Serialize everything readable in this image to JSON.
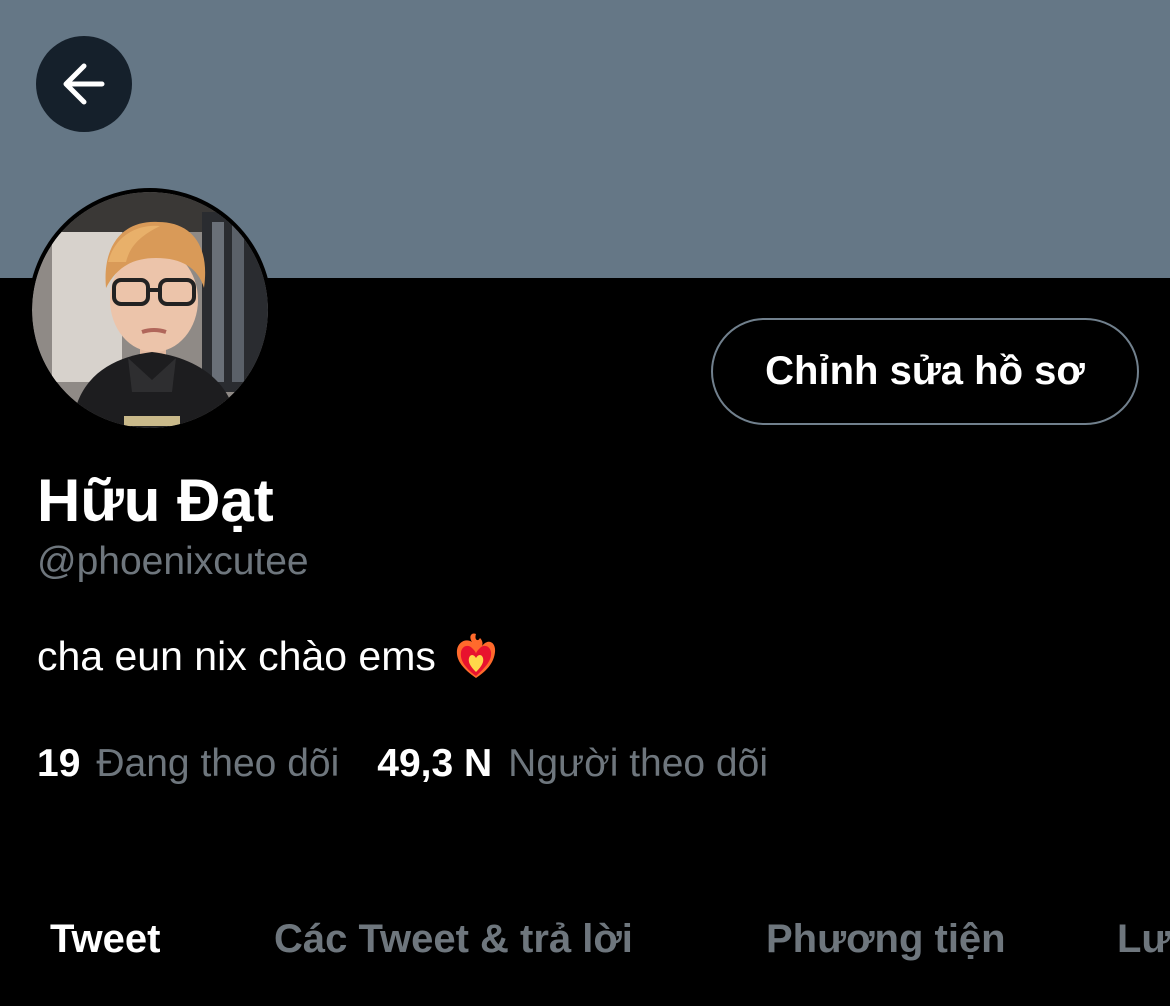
{
  "profile": {
    "edit_button": "Chỉnh sửa hồ sơ",
    "display_name": "Hữu Đạt",
    "handle": "@phoenixcutee",
    "bio": "cha eun nix chào ems",
    "bio_emoji": "heart-on-fire-icon"
  },
  "stats": {
    "following_count": "19",
    "following_label": "Đang theo dõi",
    "followers_count": "49,3 N",
    "followers_label": "Người theo dõi"
  },
  "tabs": [
    {
      "label": "Tweet",
      "active": true
    },
    {
      "label": "Các Tweet & trả lời",
      "active": false
    },
    {
      "label": "Phương tiện",
      "active": false
    },
    {
      "label": "Lượt thích",
      "active": false
    }
  ],
  "colors": {
    "background": "#000000",
    "banner": "#657786",
    "back_button": "#15202b",
    "secondary_text": "#6e767d",
    "primary_text": "#ffffff"
  }
}
